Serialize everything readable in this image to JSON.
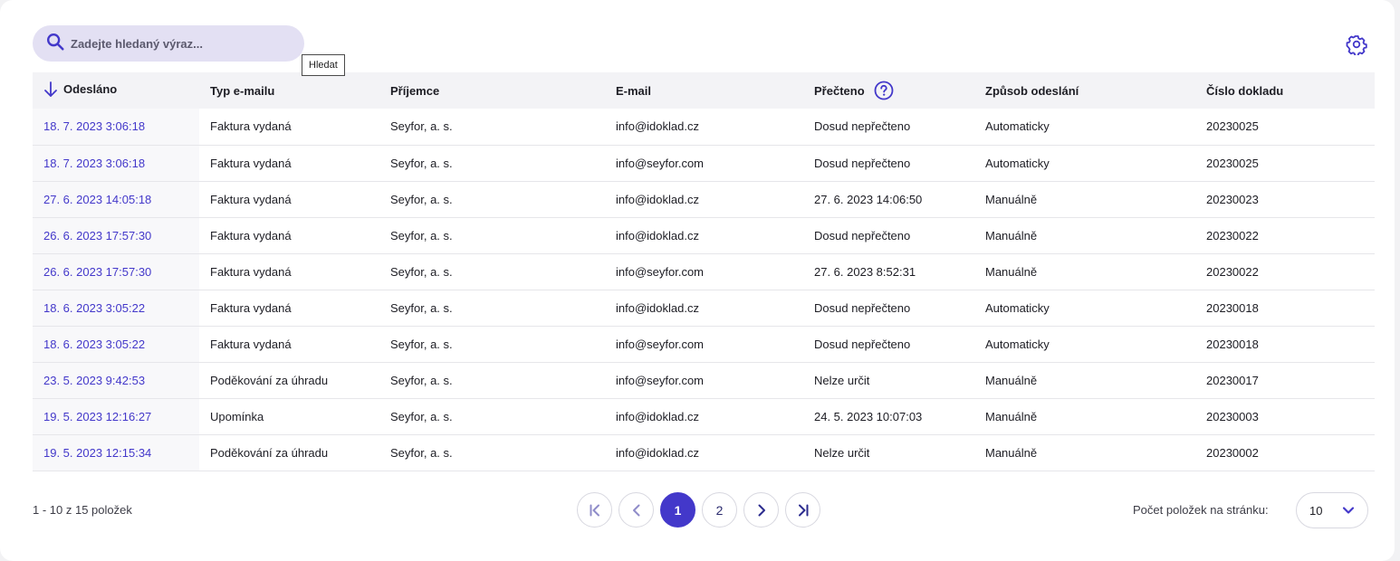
{
  "search": {
    "placeholder": "Zadejte hledaný výraz...",
    "tooltip": "Hledat"
  },
  "table": {
    "columns": [
      "Odesláno",
      "Typ e-mailu",
      "Příjemce",
      "E-mail",
      "Přečteno",
      "Způsob odeslání",
      "Číslo dokladu"
    ],
    "rows": [
      [
        "18. 7. 2023 3:06:18",
        "Faktura vydaná",
        "Seyfor, a. s.",
        "info@idoklad.cz",
        "Dosud nepřečteno",
        "Automaticky",
        "20230025"
      ],
      [
        "18. 7. 2023 3:06:18",
        "Faktura vydaná",
        "Seyfor, a. s.",
        "info@seyfor.com",
        "Dosud nepřečteno",
        "Automaticky",
        "20230025"
      ],
      [
        "27. 6. 2023 14:05:18",
        "Faktura vydaná",
        "Seyfor, a. s.",
        "info@idoklad.cz",
        "27. 6. 2023 14:06:50",
        "Manuálně",
        "20230023"
      ],
      [
        "26. 6. 2023 17:57:30",
        "Faktura vydaná",
        "Seyfor, a. s.",
        "info@idoklad.cz",
        "Dosud nepřečteno",
        "Manuálně",
        "20230022"
      ],
      [
        "26. 6. 2023 17:57:30",
        "Faktura vydaná",
        "Seyfor, a. s.",
        "info@seyfor.com",
        "27. 6. 2023 8:52:31",
        "Manuálně",
        "20230022"
      ],
      [
        "18. 6. 2023 3:05:22",
        "Faktura vydaná",
        "Seyfor, a. s.",
        "info@idoklad.cz",
        "Dosud nepřečteno",
        "Automaticky",
        "20230018"
      ],
      [
        "18. 6. 2023 3:05:22",
        "Faktura vydaná",
        "Seyfor, a. s.",
        "info@seyfor.com",
        "Dosud nepřečteno",
        "Automaticky",
        "20230018"
      ],
      [
        "23. 5. 2023 9:42:53",
        "Poděkování za úhradu",
        "Seyfor, a. s.",
        "info@seyfor.com",
        "Nelze určit",
        "Manuálně",
        "20230017"
      ],
      [
        "19. 5. 2023 12:16:27",
        "Upomínka",
        "Seyfor, a. s.",
        "info@idoklad.cz",
        "24. 5. 2023 10:07:03",
        "Manuálně",
        "20230003"
      ],
      [
        "19. 5. 2023 12:15:34",
        "Poděkování za úhradu",
        "Seyfor, a. s.",
        "info@idoklad.cz",
        "Nelze určit",
        "Manuálně",
        "20230002"
      ]
    ]
  },
  "footer": {
    "count_text": "1 - 10 z 15 položek",
    "pages": [
      "1",
      "2"
    ],
    "current_page": "1",
    "per_page_label": "Počet položek na stránku:",
    "per_page_value": "10"
  },
  "colors": {
    "accent": "#4338ca",
    "search_bg": "#e3e0f3",
    "header_bg": "#f3f3f6"
  },
  "icons": [
    "search-icon",
    "settings-gear-icon",
    "sort-arrow-down-icon",
    "help-question-icon",
    "first-page-icon",
    "prev-page-icon",
    "next-page-icon",
    "last-page-icon",
    "chevron-down-icon"
  ]
}
